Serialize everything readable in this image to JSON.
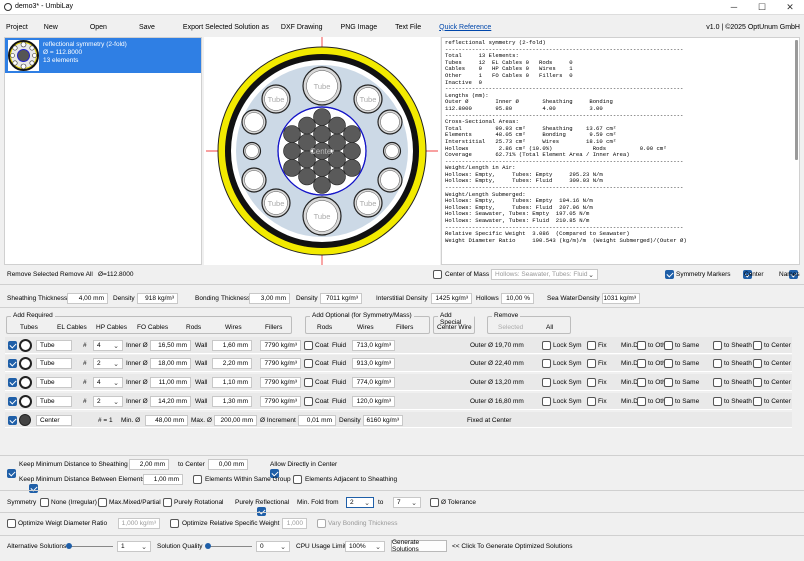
{
  "window": {
    "title": "demo3* - UmbiLay"
  },
  "menu": {
    "items": [
      "Project",
      "New",
      "Open",
      "Save",
      "Export Selected Solution as",
      "DXF Drawing",
      "PNG Image",
      "Text File"
    ],
    "quick_ref": "Quick Reference",
    "version": "v1.0 | ©2025 OptUnum GmbH"
  },
  "solution": {
    "name": "reflectional symmetry (2-fold)",
    "outer": "Ø = 112.8000",
    "elements": "13 elements"
  },
  "drawing": {
    "tube_label": "Tube",
    "center_label": "Center"
  },
  "report": {
    "text": "reflectional symmetry (2-fold)\n-----------------------------------------------------------------------\nTotal     13 Elements:\nTubes     12  EL Cables 0   Rods     0\nCables    0   HP Cables 0   Wires    1\nOther     1   FO Cables 0   Fillers  0\nInactive  0\n-----------------------------------------------------------------------\nLengths (mm):\nOuter Ø        Inner Ø       Sheathing     Bonding\n112.8000       95.80         4.00          3.00\n-----------------------------------------------------------------------\nCross-Sectional Areas:\nTotal          99.93 cm²     Sheathing    13.67 cm²\nElements       48.05 cm²     Bonding       9.59 cm²\nInterstitial   25.73 cm²     Wires        18.10 cm²\nHollows         2.86 cm² (10.0%)            Rods          0.00 cm²\nCoverage       62.71% (Total Element Area / Inner Area)\n-----------------------------------------------------------------------\nWeight/Length in Air:\nHollows: Empty,     Tubes: Empty     295.23 N/m\nHollows: Empty,     Tubes: Fluid     309.03 N/m\n-----------------------------------------------------------------------\nWeight/Length Submerged:\nHollows: Empty,     Tubes: Empty  194.16 N/m\nHollows: Empty,     Tubes: Fluid  207.96 N/m\nHollows: Seawater, Tubes: Empty  197.05 N/m\nHollows: Seawater, Tubes: Fluid  210.85 N/m\n-----------------------------------------------------------------------\nRelative Specific Weight  3.086  (Compared to Seawater)\nWeight Diameter Ratio     190.543 (kg/m)/m  (Weight Submerged)/(Outer Ø)"
  },
  "actions": {
    "remove_selected": "Remove Selected",
    "remove_all": "Remove All",
    "outer": "Ø=112.8000",
    "center_of_mass": "Center of Mass",
    "com_option": "Hollows: Seawater, Tubes: Fluid",
    "symmetry_markers": "Symmetry Markers",
    "center": "Center",
    "names": "Names"
  },
  "params": {
    "sheathing": "Sheathing",
    "thickness": "Thickness",
    "sh_thickness": "4,00 mm",
    "density": "Density",
    "sh_density": "918 kg/m³",
    "bonding": "Bonding",
    "bo_thickness": "3,00 mm",
    "bo_density": "7011 kg/m³",
    "interstitial": "Interstitial",
    "in_density": "1425 kg/m³",
    "hollows": "Hollows",
    "hollows_val": "10,00 %",
    "seawater": "Sea Water",
    "sw_density": "1031 kg/m³"
  },
  "add_required": {
    "title": "Add Required",
    "buttons": [
      "Tubes",
      "EL Cables",
      "HP Cables",
      "FO Cables",
      "Rods",
      "Wires",
      "Fillers"
    ]
  },
  "add_optional": {
    "title": "Add Optional (for Symmetry/Mass)",
    "buttons": [
      "Rods",
      "Wires",
      "Fillers"
    ]
  },
  "add_special": {
    "title": "Add Special",
    "buttons": [
      "Center Wire"
    ]
  },
  "remove": {
    "title": "Remove",
    "buttons": [
      "Selected",
      "All"
    ]
  },
  "rows": [
    {
      "type": "Tube",
      "hash": "#",
      "count": "4",
      "inner_lbl": "Inner Ø",
      "inner": "16,50 mm",
      "wall_lbl": "Wall",
      "wall": "1,60 mm",
      "density": "7790 kg/m³",
      "coat": "Coat",
      "fluid_lbl": "Fluid",
      "fluid": "713,0 kg/m³",
      "outer": "Outer Ø 19,70 mm"
    },
    {
      "type": "Tube",
      "hash": "#",
      "count": "2",
      "inner_lbl": "Inner Ø",
      "inner": "18,00 mm",
      "wall_lbl": "Wall",
      "wall": "2,20 mm",
      "density": "7790 kg/m³",
      "coat": "Coat",
      "fluid_lbl": "Fluid",
      "fluid": "913,0 kg/m³",
      "outer": "Outer Ø 22,40 mm"
    },
    {
      "type": "Tube",
      "hash": "#",
      "count": "4",
      "inner_lbl": "Inner Ø",
      "inner": "11,00 mm",
      "wall_lbl": "Wall",
      "wall": "1,10 mm",
      "density": "7790 kg/m³",
      "coat": "Coat",
      "fluid_lbl": "Fluid",
      "fluid": "774,0 kg/m³",
      "outer": "Outer Ø 13,20 mm"
    },
    {
      "type": "Tube",
      "hash": "#",
      "count": "2",
      "inner_lbl": "Inner Ø",
      "inner": "14,20 mm",
      "wall_lbl": "Wall",
      "wall": "1,30 mm",
      "density": "7790 kg/m³",
      "coat": "Coat",
      "fluid_lbl": "Fluid",
      "fluid": "120,0 kg/m³",
      "outer": "Outer Ø 16,80 mm"
    }
  ],
  "row_opts": [
    "Lock Sym",
    "Fix",
    "Min.Dist.",
    "to Other",
    "to Same",
    "to Sheath",
    "to Center"
  ],
  "center_row": {
    "type": "Center",
    "count": "# = 1",
    "min_lbl": "Min. Ø",
    "min": "48,00 mm",
    "max_lbl": "Max. Ø",
    "max": "200,00 mm",
    "inc_lbl": "Ø Increment",
    "inc": "0,01 mm",
    "dens_lbl": "Density",
    "dens": "6160 kg/m³",
    "fixed": "Fixed at Center"
  },
  "constraints": {
    "keep_min_sheath": "Keep Minimum Distance  to Sheathing",
    "sheath_val": "2,00 mm",
    "to_center": "to Center",
    "center_val": "0,00 mm",
    "allow_directly": "Allow Directly in Center",
    "keep_min_elements": "Keep Minimum Distance Between  Elements",
    "elements_val": "1,00 mm",
    "within_same": "Elements Within Same Group",
    "adjacent": "Elements Adjacent to Sheathing"
  },
  "symmetry": {
    "label": "Symmetry",
    "options": [
      "None (Irregular)",
      "Max.Mixed/Partial",
      "Purely Rotational",
      "Purely Reflectional"
    ],
    "min_fold": "Min. Fold  from",
    "from": "2",
    "to_lbl": "to",
    "to": "7",
    "tolerance": "Ø Tolerance"
  },
  "optimize": {
    "weight_ratio": "Optimize Weigt Diameter Ratio",
    "ratio_val": "1,000 kg/m³",
    "rel_weight": "Optimize Relative Specific Weight",
    "rel_val": "1,000",
    "vary": "Vary Bonding Thickness"
  },
  "bottom": {
    "alt": "Alternative Solutions",
    "alt_val": "1",
    "quality": "Solution Quality",
    "quality_val": "0",
    "cpu": "CPU Usage Limit",
    "cpu_val": "100%",
    "generate": "Generate Solutions",
    "hint": "<< Click To Generate Optimized Solutions"
  }
}
